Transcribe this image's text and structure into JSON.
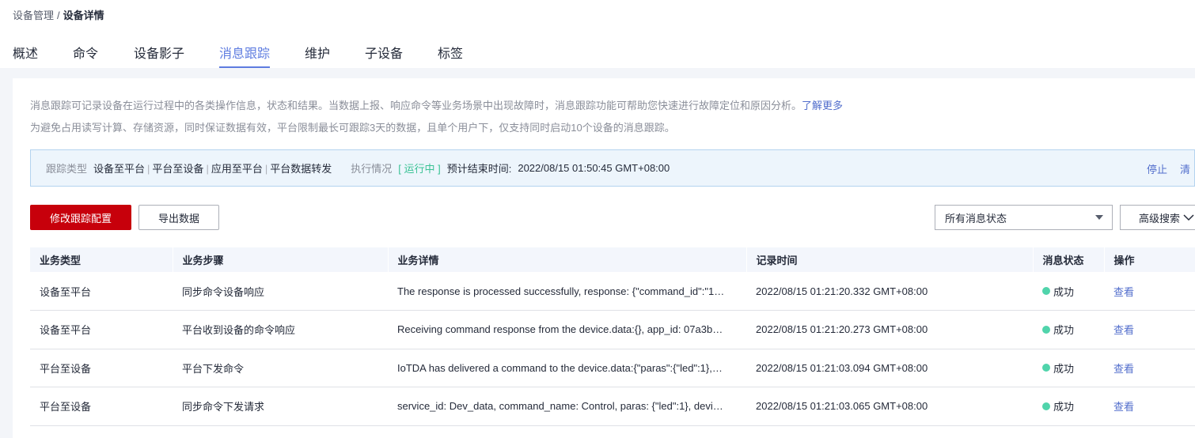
{
  "breadcrumb": {
    "parent": "设备管理",
    "separator": "/",
    "current": "设备详情"
  },
  "tabs": [
    {
      "label": "概述"
    },
    {
      "label": "命令"
    },
    {
      "label": "设备影子"
    },
    {
      "label": "消息跟踪"
    },
    {
      "label": "维护"
    },
    {
      "label": "子设备"
    },
    {
      "label": "标签"
    }
  ],
  "active_tab": "消息跟踪",
  "description": {
    "line1": "消息跟踪可记录设备在运行过程中的各类操作信息，状态和结果。当数据上报、响应命令等业务场景中出现故障时，消息跟踪功能可帮助您快速进行故障定位和原因分析。",
    "learn_more": "了解更多",
    "line2": "为避免占用读写计算、存储资源，同时保证数据有效，平台限制最长可跟踪3天的数据，且单个用户下，仅支持同时启动10个设备的消息跟踪。"
  },
  "trace": {
    "type_label": "跟踪类型",
    "types": [
      "设备至平台",
      "平台至设备",
      "应用至平台",
      "平台数据转发"
    ],
    "exec_label": "执行情况",
    "status": "[ 运行中 ]",
    "end_time_label": "预计结束时间:",
    "end_time": "2022/08/15 01:50:45 GMT+08:00",
    "stop": "停止",
    "clear": "清"
  },
  "toolbar": {
    "modify_label": "修改跟踪配置",
    "export_label": "导出数据",
    "status_filter": "所有消息状态",
    "advanced_search": "高级搜索"
  },
  "table": {
    "headers": [
      "业务类型",
      "业务步骤",
      "业务详情",
      "记录时间",
      "消息状态",
      "操作"
    ],
    "rows": [
      {
        "type": "设备至平台",
        "step": "同步命令设备响应",
        "detail": "The response is processed successfully, response: {\"command_id\":\"1…",
        "time": "2022/08/15 01:21:20.332 GMT+08:00",
        "status": "成功",
        "action": "查看"
      },
      {
        "type": "设备至平台",
        "step": "平台收到设备的命令响应",
        "detail": "Receiving command response from the device.data:{}, app_id: 07a3b…",
        "time": "2022/08/15 01:21:20.273 GMT+08:00",
        "status": "成功",
        "action": "查看"
      },
      {
        "type": "平台至设备",
        "step": "平台下发命令",
        "detail": "IoTDA has delivered a command to the device.data:{\"paras\":{\"led\":1},…",
        "time": "2022/08/15 01:21:03.094 GMT+08:00",
        "status": "成功",
        "action": "查看"
      },
      {
        "type": "平台至设备",
        "step": "同步命令下发请求",
        "detail": "service_id: Dev_data, command_name: Control, paras: {\"led\":1}, devi…",
        "time": "2022/08/15 01:21:03.065 GMT+08:00",
        "status": "成功",
        "action": "查看"
      }
    ]
  },
  "colors": {
    "accent": "#5e7ce0",
    "primary_button": "#c7000b",
    "success": "#50d4ab",
    "link": "#526ecc"
  }
}
